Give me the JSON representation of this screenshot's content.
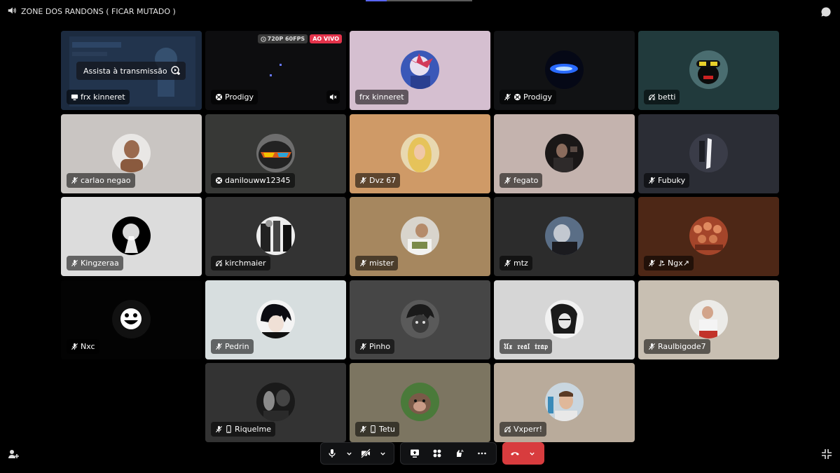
{
  "header": {
    "channel_name": "ZONE DOS RANDONS ( FICAR MUTADO )"
  },
  "stream": {
    "watch_label": "Assista à transmissão",
    "quality_badge": "720P 60FPS",
    "live_badge": "AO VIVO"
  },
  "colors": {
    "accent": "#5865f2",
    "danger": "#d83c3e",
    "live": "#e4334b"
  },
  "tiles": [
    {
      "name": "frx kinneret",
      "icon": "screen-share-icon"
    },
    {
      "name": "Prodigy",
      "icon": "xbox-icon"
    },
    {
      "name": "frx kinneret"
    },
    {
      "name": "Prodigy",
      "icon": "muted-mic-icon xbox-icon"
    },
    {
      "name": "betti",
      "icon": "muted-mic-icon"
    },
    {
      "name": "carlao negao",
      "icon": "muted-mic-icon"
    },
    {
      "name": "danilouww12345",
      "icon": "xbox-icon"
    },
    {
      "name": "Dvz 67",
      "icon": "muted-mic-icon"
    },
    {
      "name": "fegato",
      "icon": "muted-mic-icon"
    },
    {
      "name": "Fubuky",
      "icon": "muted-mic-icon"
    },
    {
      "name": "Kingzeraa",
      "icon": "muted-mic-icon"
    },
    {
      "name": "kirchmaier",
      "icon": "deafened-icon"
    },
    {
      "name": "mister",
      "icon": "muted-mic-icon"
    },
    {
      "name": "mtz",
      "icon": "muted-mic-icon"
    },
    {
      "name": "Ngx↗",
      "icon": "muted-mic-icon playstation-icon"
    },
    {
      "name": "Nxc",
      "icon": "muted-mic-icon"
    },
    {
      "name": "Pedrin",
      "icon": "muted-mic-icon"
    },
    {
      "name": "Pinho",
      "icon": "muted-mic-icon"
    },
    {
      "name": "𝔘𝔵 𝔯𝔢𝔞𝔩 𝔱𝔯𝔞𝔭"
    },
    {
      "name": "Raulbigode7",
      "icon": "muted-mic-icon"
    },
    {
      "name": "Riquelme",
      "icon": "muted-mic-icon mobile-icon"
    },
    {
      "name": "Tetu",
      "icon": "muted-mic-icon mobile-icon"
    },
    {
      "name": "Vxperr!",
      "icon": "deafened-icon"
    }
  ]
}
